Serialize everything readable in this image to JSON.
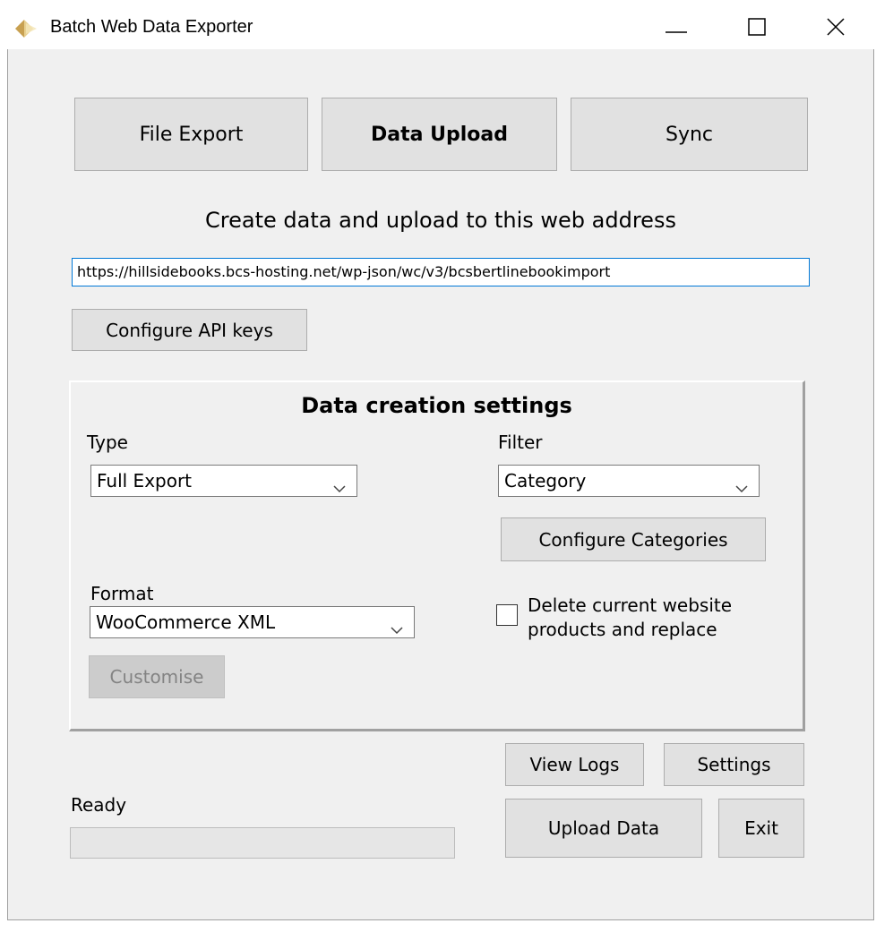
{
  "window": {
    "title": "Batch Web Data Exporter"
  },
  "tabs": {
    "file_export": "File Export",
    "data_upload": "Data Upload",
    "sync": "Sync"
  },
  "upload": {
    "heading": "Create data and upload to this web address",
    "url": "https://hillsidebooks.bcs-hosting.net/wp-json/wc/v3/bcsbertlinebookimport",
    "configure_api_keys": "Configure API keys"
  },
  "settings_group": {
    "title": "Data creation settings",
    "type_label": "Type",
    "type_value": "Full Export",
    "filter_label": "Filter",
    "filter_value": "Category",
    "configure_categories": "Configure Categories",
    "format_label": "Format",
    "format_value": "WooCommerce XML",
    "customise": "Customise",
    "delete_line1": "Delete current website",
    "delete_line2": "products and replace",
    "delete_checked": false
  },
  "footer": {
    "view_logs": "View Logs",
    "settings": "Settings",
    "upload_data": "Upload Data",
    "exit": "Exit",
    "status": "Ready",
    "progress": 0
  },
  "icons": {
    "app": "app-diamond-icon",
    "minimize": "minimize-icon",
    "maximize": "maximize-icon",
    "close": "close-icon",
    "dropdown": "chevron-down-icon"
  }
}
